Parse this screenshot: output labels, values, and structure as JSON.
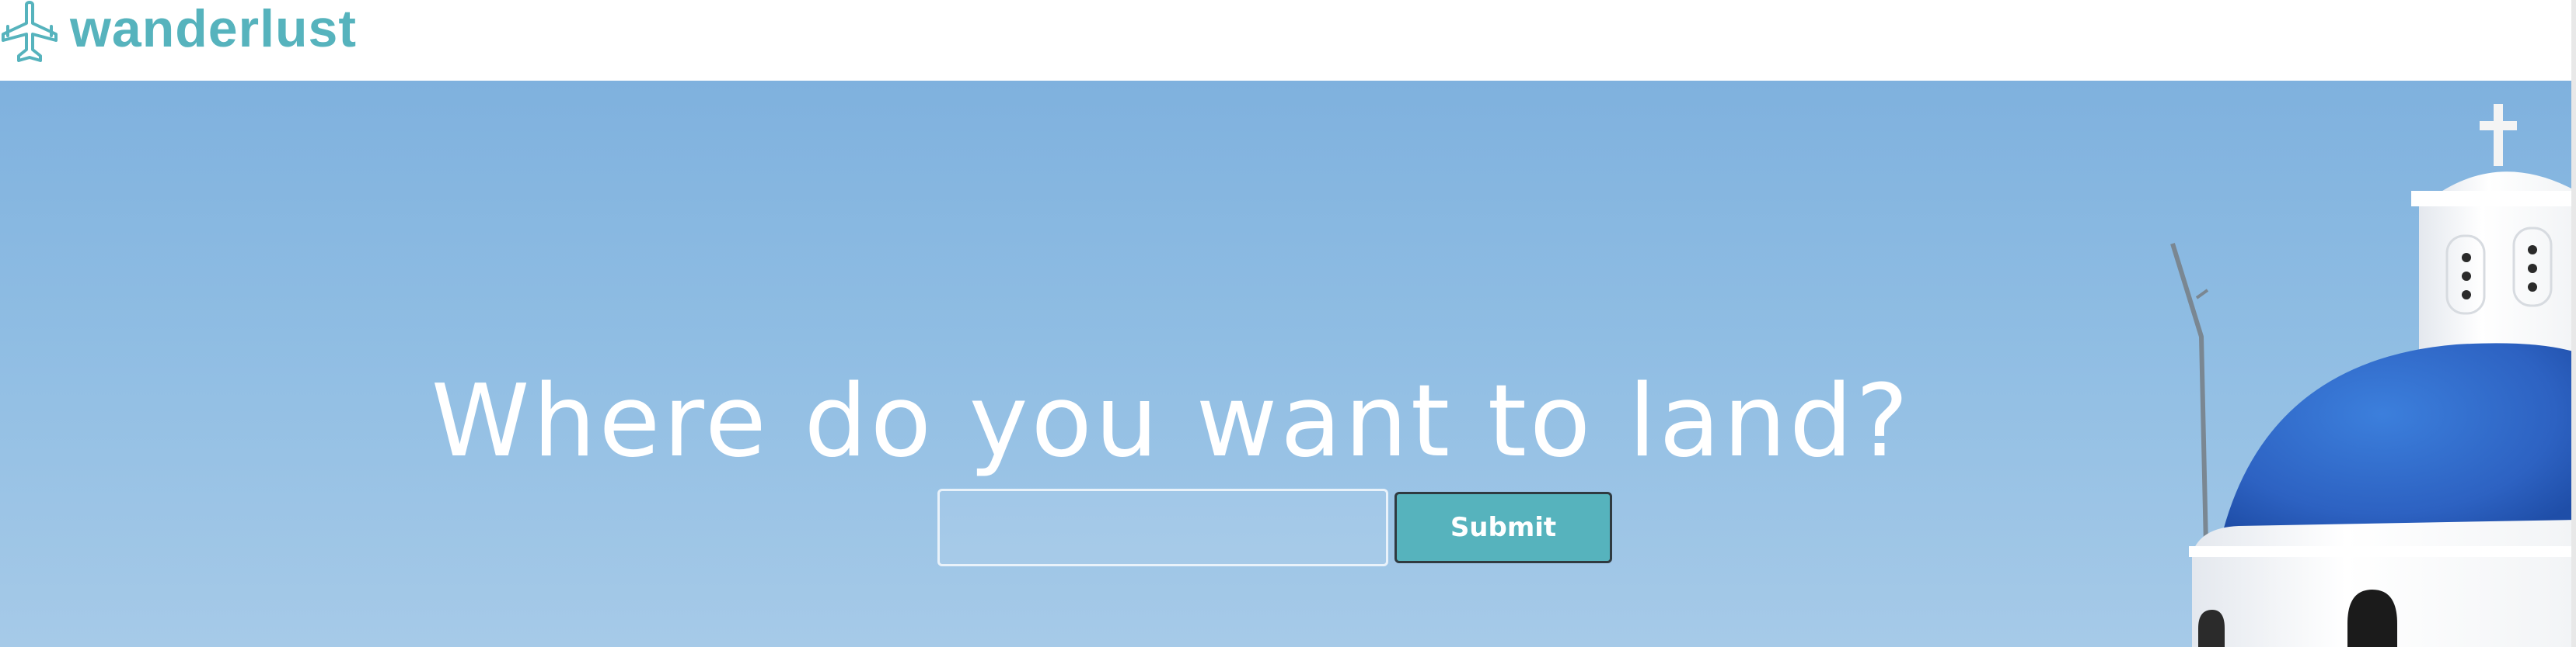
{
  "header": {
    "brand": "wanderlust",
    "logo_icon": "airplane-icon",
    "brand_color": "#56b3bd"
  },
  "hero": {
    "headline": "Where do you want to land?",
    "search": {
      "value": "",
      "placeholder": ""
    },
    "submit_label": "Submit",
    "accent_color": "#56b3bd",
    "sky_color": "#8fbde3",
    "dome_color": "#2e66c6"
  }
}
